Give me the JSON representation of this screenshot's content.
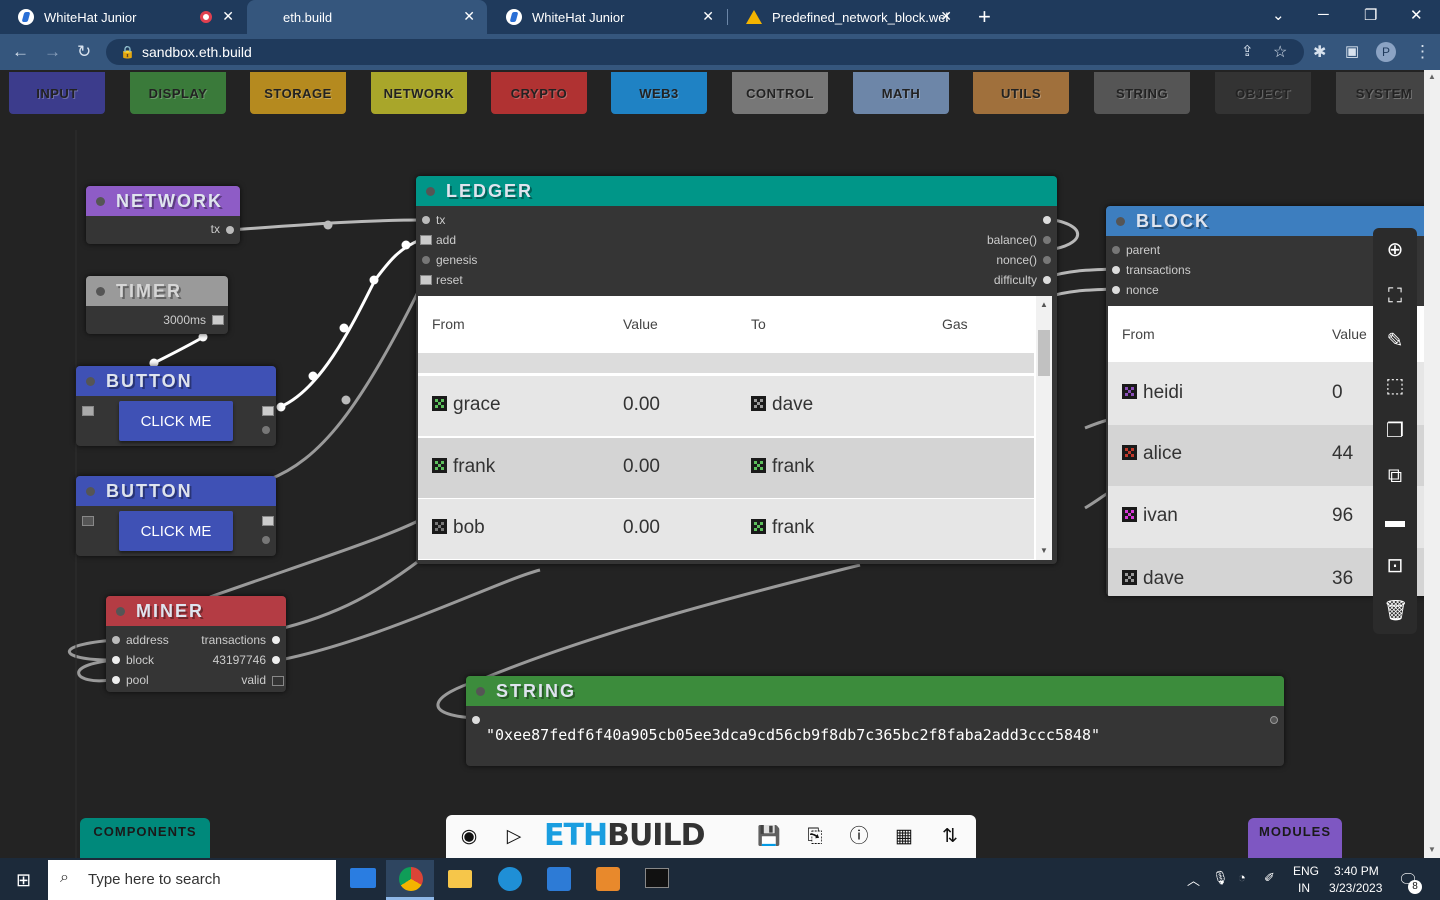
{
  "browser": {
    "tabs": [
      {
        "title": "WhiteHat Junior",
        "recording": true
      },
      {
        "title": "eth.build",
        "active": true
      },
      {
        "title": "WhiteHat Junior"
      },
      {
        "title": "Predefined_network_block.weblo"
      }
    ],
    "url": "sandbox.eth.build",
    "profile_initial": "P"
  },
  "categories": [
    "INPUT",
    "DISPLAY",
    "STORAGE",
    "NETWORK",
    "CRYPTO",
    "WEB3",
    "CONTROL",
    "MATH",
    "UTILS",
    "STRING",
    "OBJECT",
    "SYSTEM"
  ],
  "category_colors": [
    "#3c3c8c",
    "#3a7a3a",
    "#b58a1f",
    "#a9a62a",
    "#b03232",
    "#1f82c4",
    "#777777",
    "#6d86a8",
    "#a0703c",
    "#555555",
    "#333333",
    "#444444"
  ],
  "nodes": {
    "network": {
      "title": "NETWORK",
      "out": "tx"
    },
    "timer": {
      "title": "TIMER",
      "interval": "3000ms"
    },
    "button1": {
      "title": "BUTTON",
      "label": "CLICK ME"
    },
    "button2": {
      "title": "BUTTON",
      "label": "CLICK ME"
    },
    "miner": {
      "title": "MINER",
      "inputs": [
        "address",
        "block",
        "pool"
      ],
      "outputs": [
        "transactions",
        "43197746",
        "valid"
      ]
    },
    "ledger": {
      "title": "LEDGER",
      "inputs": [
        "tx",
        "add",
        "genesis",
        "reset"
      ],
      "outputs": [
        "balance()",
        "nonce()",
        "difficulty"
      ],
      "columns": [
        "From",
        "Value",
        "To",
        "Gas"
      ],
      "rows": [
        {
          "from": "grace",
          "value": "0.00",
          "to": "dave"
        },
        {
          "from": "frank",
          "value": "0.00",
          "to": "frank"
        },
        {
          "from": "bob",
          "value": "0.00",
          "to": "frank"
        }
      ]
    },
    "block": {
      "title": "BLOCK",
      "inputs": [
        "parent",
        "transactions",
        "nonce"
      ],
      "columns": [
        "From",
        "Value"
      ],
      "rows": [
        {
          "from": "heidi",
          "value": "0"
        },
        {
          "from": "alice",
          "value": "44"
        },
        {
          "from": "ivan",
          "value": "96"
        },
        {
          "from": "dave",
          "value": "36"
        }
      ]
    },
    "string": {
      "title": "STRING",
      "value": "\"0xee87fedf6f40a905cb05ee3dca9cd56cb9f8db7c365bc2f8faba2add3ccc5848\""
    }
  },
  "corner_buttons": {
    "components": "COMPONENTS",
    "modules": "MODULES"
  },
  "logo": {
    "part1": "ETH",
    "part2": "BUILD"
  },
  "taskbar": {
    "search_placeholder": "Type here to search",
    "lang": "ENG",
    "region": "IN",
    "time": "3:40 PM",
    "date": "3/23/2023",
    "notif_count": "8"
  }
}
